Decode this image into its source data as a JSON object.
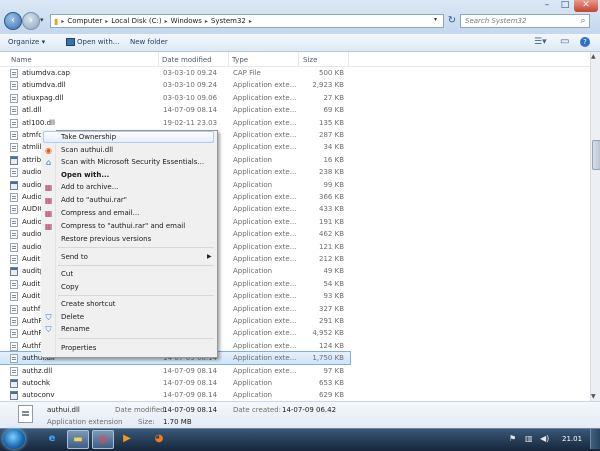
{
  "address": {
    "crumbs": [
      "Computer",
      "Local Disk (C:)",
      "Windows",
      "System32"
    ],
    "search_placeholder": "Search System32"
  },
  "toolbar": {
    "organize": "Organize ▾",
    "open_with": "Open with...",
    "new_folder": "New folder"
  },
  "columns": {
    "name": "Name",
    "date": "Date modified",
    "type": "Type",
    "size": "Size"
  },
  "files": [
    {
      "name": "atiumdva.cap",
      "date": "03-03-10 09.24",
      "type": "CAP File",
      "size": "500 KB",
      "icon": "dll-icon"
    },
    {
      "name": "atiumdva.dll",
      "date": "03-03-10 09.24",
      "type": "Application exte...",
      "size": "2,923 KB",
      "icon": "dll-icon"
    },
    {
      "name": "atiuxpag.dll",
      "date": "03-03-10 09.06",
      "type": "Application exte...",
      "size": "27 KB",
      "icon": "dll-icon"
    },
    {
      "name": "atl.dll",
      "date": "14-07-09 08.14",
      "type": "Application exte...",
      "size": "69 KB",
      "icon": "dll-icon"
    },
    {
      "name": "atl100.dll",
      "date": "19-02-11 23.03",
      "type": "Application exte...",
      "size": "135 KB",
      "icon": "dll-icon"
    },
    {
      "name": "atmfd",
      "date": "",
      "type": "Application exte...",
      "size": "287 KB",
      "icon": "dll-icon"
    },
    {
      "name": "atmlib",
      "date": "",
      "type": "Application exte...",
      "size": "34 KB",
      "icon": "dll-icon"
    },
    {
      "name": "attrib",
      "date": "",
      "type": "Application",
      "size": "16 KB",
      "icon": "app-icon"
    },
    {
      "name": "audio",
      "date": "",
      "type": "Application exte...",
      "size": "238 KB",
      "icon": "dll-icon"
    },
    {
      "name": "audio",
      "date": "",
      "type": "Application",
      "size": "99 KB",
      "icon": "app-icon"
    },
    {
      "name": "Audio",
      "date": "",
      "type": "Application exte...",
      "size": "366 KB",
      "icon": "dll-icon"
    },
    {
      "name": "AUDIO",
      "date": "",
      "type": "Application exte...",
      "size": "433 KB",
      "icon": "dll-icon"
    },
    {
      "name": "Audio",
      "date": "",
      "type": "Application exte...",
      "size": "191 KB",
      "icon": "dll-icon"
    },
    {
      "name": "audio",
      "date": "",
      "type": "Application exte...",
      "size": "462 KB",
      "icon": "dll-icon"
    },
    {
      "name": "audio",
      "date": "",
      "type": "Application exte...",
      "size": "121 KB",
      "icon": "dll-icon"
    },
    {
      "name": "Audit",
      "date": "",
      "type": "Application exte...",
      "size": "212 KB",
      "icon": "dll-icon"
    },
    {
      "name": "auditp",
      "date": "",
      "type": "Application",
      "size": "49 KB",
      "icon": "app-icon"
    },
    {
      "name": "Audit",
      "date": "",
      "type": "Application exte...",
      "size": "54 KB",
      "icon": "dll-icon"
    },
    {
      "name": "Audit",
      "date": "",
      "type": "Application exte...",
      "size": "93 KB",
      "icon": "dll-icon"
    },
    {
      "name": "authf",
      "date": "",
      "type": "Application exte...",
      "size": "327 KB",
      "icon": "dll-icon"
    },
    {
      "name": "AuthF",
      "date": "",
      "type": "Application exte...",
      "size": "291 KB",
      "icon": "dll-icon"
    },
    {
      "name": "AuthF",
      "date": "",
      "type": "Application exte...",
      "size": "4,952 KB",
      "icon": "dll-icon"
    },
    {
      "name": "Authf",
      "date": "",
      "type": "Application exte...",
      "size": "124 KB",
      "icon": "dll-icon"
    },
    {
      "name": "authui.dll",
      "date": "14-07-09 08.14",
      "type": "Application exte...",
      "size": "1,750 KB",
      "icon": "dll-icon",
      "selected": true
    },
    {
      "name": "authz.dll",
      "date": "14-07-09 08.14",
      "type": "Application exte...",
      "size": "97 KB",
      "icon": "dll-icon"
    },
    {
      "name": "autochk",
      "date": "14-07-09 08.14",
      "type": "Application",
      "size": "653 KB",
      "icon": "app-icon"
    },
    {
      "name": "autoconv",
      "date": "14-07-09 08.14",
      "type": "Application",
      "size": "629 KB",
      "icon": "app-icon"
    }
  ],
  "context_menu": {
    "take_ownership": "Take Ownership",
    "scan": "Scan authui.dll",
    "scan_mse": "Scan with Microsoft Security Essentials...",
    "open_with": "Open with...",
    "add_archive": "Add to archive...",
    "add_rar": "Add to \"authui.rar\"",
    "compress_email": "Compress and email...",
    "compress_rar_email": "Compress to \"authui.rar\" and email",
    "restore": "Restore previous versions",
    "send_to": "Send to",
    "cut": "Cut",
    "copy": "Copy",
    "create_shortcut": "Create shortcut",
    "delete": "Delete",
    "rename": "Rename",
    "properties": "Properties"
  },
  "details": {
    "name": "authui.dll",
    "type": "Application extension",
    "modified_label": "Date modified:",
    "modified_value": "14-07-09 08.14",
    "size_label": "Size:",
    "size_value": "1.70 MB",
    "created_label": "Date created:",
    "created_value": "14-07-09 06.42"
  },
  "taskbar": {
    "clock": "21.01"
  },
  "colors": {
    "selection": "#cfe4fa",
    "accent": "#3a6fb1",
    "taskbar": "#15263c"
  }
}
